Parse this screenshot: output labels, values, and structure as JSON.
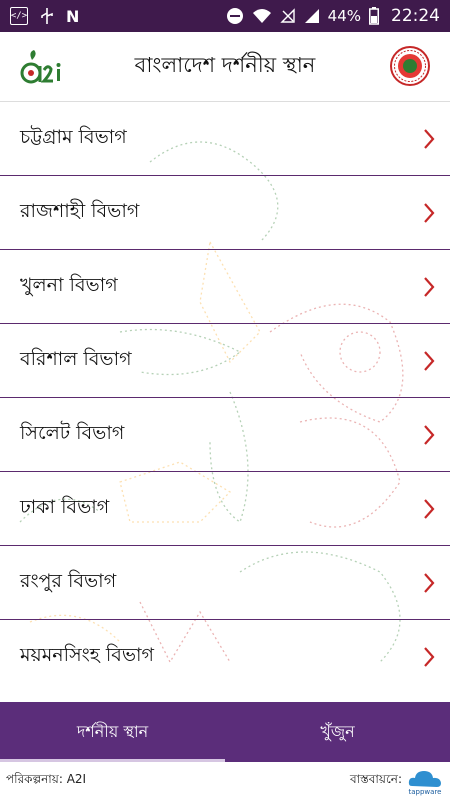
{
  "status_bar": {
    "battery": "44%",
    "time": "22:24",
    "icons": [
      "code-icon",
      "usb-icon",
      "n-icon",
      "dnd-icon",
      "wifi-icon",
      "no-sim-icon",
      "signal-icon",
      "battery-icon"
    ]
  },
  "app_bar": {
    "title": "বাংলাদেশ দর্শনীয় স্থান",
    "logo_text": "a2i"
  },
  "divisions": [
    "চট্টগ্রাম বিভাগ",
    "রাজশাহী বিভাগ",
    "খুলনা বিভাগ",
    "বরিশাল বিভাগ",
    "সিলেট বিভাগ",
    "ঢাকা বিভাগ",
    "রংপুর বিভাগ",
    "ময়মনসিংহ বিভাগ"
  ],
  "bottom_nav": {
    "tabs": [
      "দর্শনীয় স্থান",
      "খুঁজুন"
    ],
    "active": 0
  },
  "footer": {
    "left": "পরিকল্পনায়: A2I",
    "right": "বাস্তবায়নে:",
    "brand": "tappware"
  },
  "colors": {
    "status_bar": "#3f1a4c",
    "primary": "#5b2d7a",
    "chevron": "#c62828"
  }
}
